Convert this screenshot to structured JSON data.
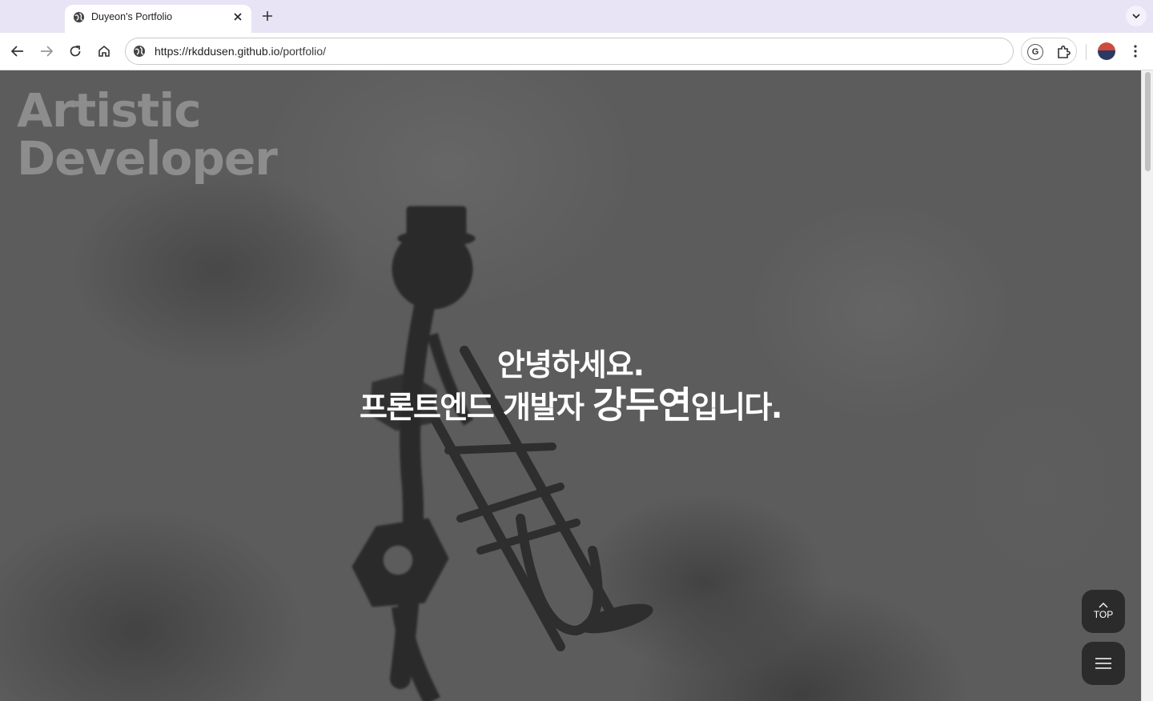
{
  "browser": {
    "tab": {
      "title": "Duyeon's Portfolio"
    },
    "url": {
      "host": "https://rkddusen.github.io",
      "path": "/portfolio/"
    }
  },
  "page": {
    "brand": {
      "line1": "Artistic",
      "line2": "Developer"
    },
    "greeting": {
      "line1": "안녕하세요.",
      "line2_prefix": "프론트엔드 개발자 ",
      "name": "강두연",
      "line2_suffix": "입니다."
    },
    "top_button_label": "TOP"
  },
  "icons": [
    "globe-icon",
    "close-icon",
    "plus-icon",
    "chevron-down-icon",
    "back-arrow-icon",
    "forward-arrow-icon",
    "reload-icon",
    "home-icon",
    "site-info-icon",
    "extension-g-icon",
    "puzzle-icon",
    "avatar",
    "more-vert-icon",
    "chevron-up-icon",
    "hamburger-icon"
  ]
}
